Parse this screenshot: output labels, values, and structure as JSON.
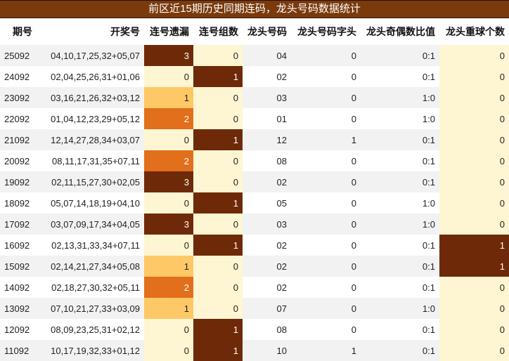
{
  "title": "前区近15期历史同期连码，龙头号码数据统计",
  "headers": [
    "期号",
    "开奖号",
    "连号遗漏",
    "连号组数",
    "龙头号码",
    "龙头号码字头",
    "龙头奇偶数比值",
    "龙头重球个数"
  ],
  "rows": [
    [
      "25092",
      "04,10,17,25,32+05,07",
      "3",
      "0",
      "04",
      "0",
      "0:1",
      "0"
    ],
    [
      "24092",
      "02,04,25,26,31+01,06",
      "0",
      "1",
      "02",
      "0",
      "0:1",
      "0"
    ],
    [
      "23092",
      "03,16,21,26,32+03,12",
      "1",
      "0",
      "03",
      "0",
      "1:0",
      "0"
    ],
    [
      "22092",
      "01,04,12,23,29+05,12",
      "2",
      "0",
      "01",
      "0",
      "1:0",
      "0"
    ],
    [
      "21092",
      "12,14,27,28,34+03,07",
      "0",
      "1",
      "12",
      "1",
      "0:1",
      "0"
    ],
    [
      "20092",
      "08,11,17,31,35+07,11",
      "2",
      "0",
      "08",
      "0",
      "0:1",
      "0"
    ],
    [
      "19092",
      "02,11,15,27,30+02,05",
      "3",
      "0",
      "02",
      "0",
      "0:1",
      "0"
    ],
    [
      "18092",
      "05,07,14,18,19+04,10",
      "0",
      "1",
      "05",
      "0",
      "1:0",
      "0"
    ],
    [
      "17092",
      "03,07,09,17,34+04,05",
      "3",
      "0",
      "03",
      "0",
      "1:0",
      "0"
    ],
    [
      "16092",
      "02,13,31,33,34+07,11",
      "0",
      "1",
      "02",
      "0",
      "0:1",
      "1"
    ],
    [
      "15092",
      "02,14,21,27,34+05,08",
      "1",
      "0",
      "02",
      "0",
      "0:1",
      "1"
    ],
    [
      "14092",
      "02,18,27,30,32+05,11",
      "2",
      "0",
      "02",
      "0",
      "0:1",
      "0"
    ],
    [
      "13092",
      "07,10,21,27,33+03,09",
      "1",
      "0",
      "07",
      "0",
      "1:0",
      "0"
    ],
    [
      "12092",
      "08,09,23,25,31+02,12",
      "0",
      "1",
      "08",
      "0",
      "0:1",
      "0"
    ],
    [
      "11092",
      "10,17,19,32,33+01,12",
      "0",
      "1",
      "10",
      "1",
      "0:1",
      "0"
    ]
  ],
  "colors": {
    "title_bg": "#7a3a0c",
    "dark": "#6e2a08",
    "orange": "#e16f1b",
    "yellow": "#fec866",
    "cream": "#fef6d3",
    "stripe": "#f2f2f2"
  }
}
